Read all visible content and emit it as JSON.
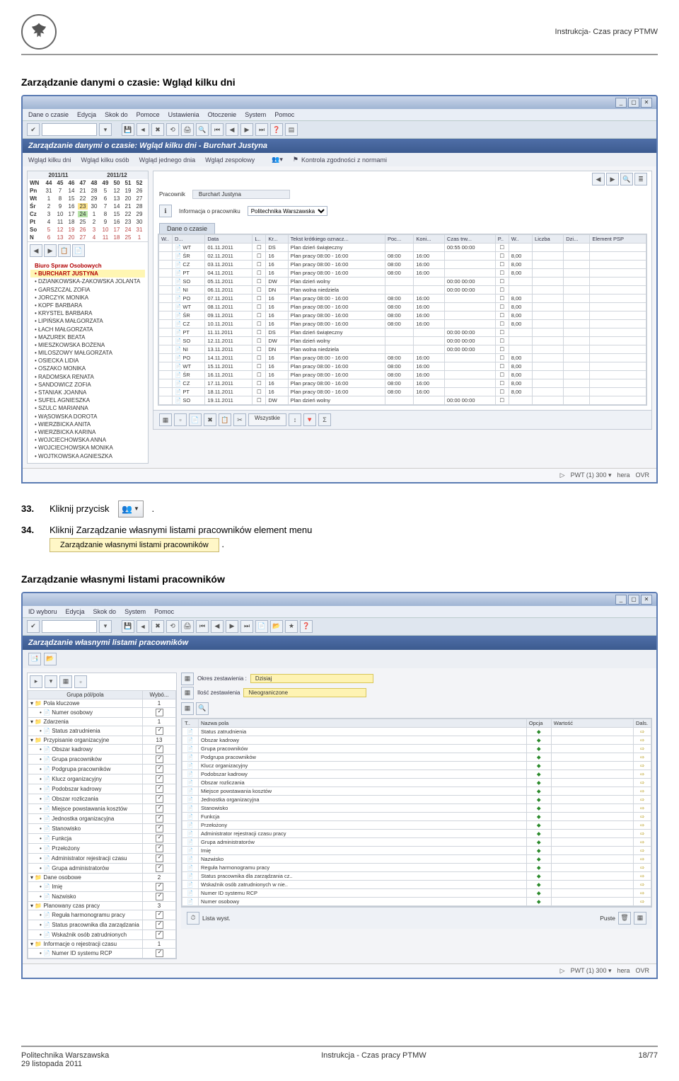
{
  "doc": {
    "header_title": "Instrukcja- Czas pracy PTMW",
    "footer_org": "Politechnika Warszawska",
    "footer_date": "29 listopada 2011",
    "footer_center": "Instrukcja - Czas pracy PTMW",
    "footer_page": "18/77"
  },
  "heading1": "Zarządzanie danymi o czasie: Wgląd kilku dni",
  "heading2": "Zarządzanie własnymi listami pracowników",
  "steps": {
    "n33": "33.",
    "s33_text": "Kliknij przycisk",
    "s33_dot": ".",
    "n34": "34.",
    "s34_text": "Kliknij Zarządzanie własnymi listami pracowników element menu",
    "s34_menu": "Zarządzanie własnymi listami pracowników",
    "s34_dot": "."
  },
  "sap1": {
    "titlebar": "",
    "menu": [
      "Dane o czasie",
      "Edycja",
      "Skok do",
      "Pomoce",
      "Ustawienia",
      "Otoczenie",
      "System",
      "Pomoc"
    ],
    "blue_title": "Zarządzanie danymi o czasie: Wgląd kilku dni - Burchart Justyna",
    "subtoolbar": [
      "Wgląd kilku dni",
      "Wgląd kilku osób",
      "Wgląd jednego dnia",
      "Wgląd zespołowy"
    ],
    "conformity_label": "Kontrola zgodności z normami",
    "cal_months": [
      "2011/11",
      "2011/12"
    ],
    "cal_head": [
      "44",
      "45",
      "46",
      "47",
      "48",
      "49",
      "50",
      "51",
      "52"
    ],
    "cal_rows": [
      {
        "l": "WN",
        "v": [
          "44",
          "45",
          "46",
          "47",
          "48",
          "49",
          "50",
          "51",
          "52"
        ]
      },
      {
        "l": "Pn",
        "v": [
          "31",
          "7",
          "14",
          "21",
          "28",
          "5",
          "12",
          "19",
          "26"
        ]
      },
      {
        "l": "Wt",
        "v": [
          "1",
          "8",
          "15",
          "22",
          "29",
          "6",
          "13",
          "20",
          "27"
        ]
      },
      {
        "l": "Śr",
        "v": [
          "2",
          "9",
          "16",
          "23",
          "30",
          "7",
          "14",
          "21",
          "28"
        ]
      },
      {
        "l": "Cz",
        "v": [
          "3",
          "10",
          "17",
          "24",
          "1",
          "8",
          "15",
          "22",
          "29"
        ]
      },
      {
        "l": "Pt",
        "v": [
          "4",
          "11",
          "18",
          "25",
          "2",
          "9",
          "16",
          "23",
          "30"
        ]
      },
      {
        "l": "So",
        "v": [
          "5",
          "12",
          "19",
          "26",
          "3",
          "10",
          "17",
          "24",
          "31"
        ]
      },
      {
        "l": "N",
        "v": [
          "6",
          "13",
          "20",
          "27",
          "4",
          "11",
          "18",
          "25",
          "1"
        ]
      }
    ],
    "group_title": "Biuro Spraw Osobowych",
    "employees": [
      "BURCHART JUSTYNA",
      "DZIANKOWSKA-ZAKOWSKA JOLANTA",
      "GARSZCZAL ZOFIA",
      "JORCZYK MONIKA",
      "KOPF BARBARA",
      "KRYSTEL BARBARA",
      "LIPIŃSKA MAŁGORZATA",
      "ŁACH MAŁGORZATA",
      "MAZUREK BEATA",
      "MIESZKOWSKA BOŻENA",
      "MILOSZOWY MAŁGORZATA",
      "OSIECKA LIDIA",
      "OSZAKO MONIKA",
      "RADOMSKA RENATA",
      "SANDOWICZ ZOFIA",
      "STANIAK JOANNA",
      "SUFEL AGNIESZKA",
      "SZULC MARIANNA",
      "WĄSOWSKA DOROTA",
      "WIERZBICKA ANITA",
      "WIERZBICKA KARINA",
      "WOJCIECHOWSKA ANNA",
      "WOJCIECHOWSKA MONIKA",
      "WOJTKOWSKA AGNIESZKA"
    ],
    "employee_label": "Pracownik",
    "employee_value": "Burchart Justyna",
    "info_label": "Informacja o pracowniku",
    "info_value": "Politechnika Warszawska",
    "tab_label": "Dane o czasie",
    "grid_headers": [
      "W..",
      "D...",
      "Data",
      "L..",
      "Kr...",
      "Tekst krótkiego oznacz...",
      "Poc...",
      "Koni...",
      "Czas trw...",
      "P..",
      "W..",
      "Liczba",
      "Dzi...",
      "Element PSP"
    ],
    "grid_rows": [
      {
        "w": "",
        "d": "WT",
        "data": "01.11.2011",
        "l": "",
        "kr": "DS",
        "t": "Plan dzień świąteczny",
        "poc": "",
        "kon": "",
        "czas": "00:55 00:00",
        "p": "",
        "wn": "",
        "licz": ""
      },
      {
        "w": "",
        "d": "ŚR",
        "data": "02.11.2011",
        "l": "",
        "kr": "16",
        "t": "Plan pracy 08:00 - 16:00",
        "poc": "08:00",
        "kon": "16:00",
        "czas": "",
        "p": "",
        "wn": "8,00",
        "licz": ""
      },
      {
        "w": "",
        "d": "CZ",
        "data": "03.11.2011",
        "l": "",
        "kr": "16",
        "t": "Plan pracy 08:00 - 16:00",
        "poc": "08:00",
        "kon": "16:00",
        "czas": "",
        "p": "",
        "wn": "8,00",
        "licz": ""
      },
      {
        "w": "",
        "d": "PT",
        "data": "04.11.2011",
        "l": "",
        "kr": "16",
        "t": "Plan pracy 08:00 - 16:00",
        "poc": "08:00",
        "kon": "16:00",
        "czas": "",
        "p": "",
        "wn": "8,00",
        "licz": ""
      },
      {
        "w": "",
        "d": "SO",
        "data": "05.11.2011",
        "l": "",
        "kr": "DW",
        "t": "Plan dzień wolny",
        "poc": "",
        "kon": "",
        "czas": "00:00 00:00",
        "p": "",
        "wn": "",
        "licz": ""
      },
      {
        "w": "",
        "d": "NI",
        "data": "06.11.2011",
        "l": "",
        "kr": "DN",
        "t": "Plan wolna niedziela",
        "poc": "",
        "kon": "",
        "czas": "00:00 00:00",
        "p": "",
        "wn": "",
        "licz": ""
      },
      {
        "w": "",
        "d": "PO",
        "data": "07.11.2011",
        "l": "",
        "kr": "16",
        "t": "Plan pracy 08:00 - 16:00",
        "poc": "08:00",
        "kon": "16:00",
        "czas": "",
        "p": "",
        "wn": "8,00",
        "licz": ""
      },
      {
        "w": "",
        "d": "WT",
        "data": "08.11.2011",
        "l": "",
        "kr": "16",
        "t": "Plan pracy 08:00 - 16:00",
        "poc": "08:00",
        "kon": "16:00",
        "czas": "",
        "p": "",
        "wn": "8,00",
        "licz": ""
      },
      {
        "w": "",
        "d": "ŚR",
        "data": "09.11.2011",
        "l": "",
        "kr": "16",
        "t": "Plan pracy 08:00 - 16:00",
        "poc": "08:00",
        "kon": "16:00",
        "czas": "",
        "p": "",
        "wn": "8,00",
        "licz": ""
      },
      {
        "w": "",
        "d": "CZ",
        "data": "10.11.2011",
        "l": "",
        "kr": "16",
        "t": "Plan pracy 08:00 - 16:00",
        "poc": "08:00",
        "kon": "16:00",
        "czas": "",
        "p": "",
        "wn": "8,00",
        "licz": ""
      },
      {
        "w": "",
        "d": "PT",
        "data": "11.11.2011",
        "l": "",
        "kr": "DS",
        "t": "Plan dzień świąteczny",
        "poc": "",
        "kon": "",
        "czas": "00:00 00:00",
        "p": "",
        "wn": "",
        "licz": ""
      },
      {
        "w": "",
        "d": "SO",
        "data": "12.11.2011",
        "l": "",
        "kr": "DW",
        "t": "Plan dzień wolny",
        "poc": "",
        "kon": "",
        "czas": "00:00 00:00",
        "p": "",
        "wn": "",
        "licz": ""
      },
      {
        "w": "",
        "d": "NI",
        "data": "13.11.2011",
        "l": "",
        "kr": "DN",
        "t": "Plan wolna niedziela",
        "poc": "",
        "kon": "",
        "czas": "00:00 00:00",
        "p": "",
        "wn": "",
        "licz": ""
      },
      {
        "w": "",
        "d": "PO",
        "data": "14.11.2011",
        "l": "",
        "kr": "16",
        "t": "Plan pracy 08:00 - 16:00",
        "poc": "08:00",
        "kon": "16:00",
        "czas": "",
        "p": "",
        "wn": "8,00",
        "licz": ""
      },
      {
        "w": "",
        "d": "WT",
        "data": "15.11.2011",
        "l": "",
        "kr": "16",
        "t": "Plan pracy 08:00 - 16:00",
        "poc": "08:00",
        "kon": "16:00",
        "czas": "",
        "p": "",
        "wn": "8,00",
        "licz": ""
      },
      {
        "w": "",
        "d": "ŚR",
        "data": "16.11.2011",
        "l": "",
        "kr": "16",
        "t": "Plan pracy 08:00 - 16:00",
        "poc": "08:00",
        "kon": "16:00",
        "czas": "",
        "p": "",
        "wn": "8,00",
        "licz": ""
      },
      {
        "w": "",
        "d": "CZ",
        "data": "17.11.2011",
        "l": "",
        "kr": "16",
        "t": "Plan pracy 08:00 - 16:00",
        "poc": "08:00",
        "kon": "16:00",
        "czas": "",
        "p": "",
        "wn": "8,00",
        "licz": ""
      },
      {
        "w": "",
        "d": "PT",
        "data": "18.11.2011",
        "l": "",
        "kr": "16",
        "t": "Plan pracy 08:00 - 16:00",
        "poc": "08:00",
        "kon": "16:00",
        "czas": "",
        "p": "",
        "wn": "8,00",
        "licz": ""
      },
      {
        "w": "",
        "d": "SO",
        "data": "19.11.2011",
        "l": "",
        "kr": "DW",
        "t": "Plan dzień wolny",
        "poc": "",
        "kon": "",
        "czas": "00:00 00:00",
        "p": "",
        "wn": "",
        "licz": ""
      }
    ],
    "bottom_label": "Wszystkie",
    "status": {
      "a": "PWT (1) 300 ▾",
      "b": "hera",
      "c": "OVR"
    }
  },
  "sap2": {
    "menu": [
      "ID wyboru",
      "Edycja",
      "Skok do",
      "System",
      "Pomoc"
    ],
    "blue_title": "Zarządzanie własnymi listami pracowników",
    "tree_headers": [
      "Grupa pól/pola",
      "Wybó..."
    ],
    "tree": [
      {
        "n": "Pola kluczowe",
        "v": "1",
        "ch": [
          {
            "n": "Numer osobowy",
            "v": "✓"
          }
        ]
      },
      {
        "n": "Zdarzenia",
        "v": "1",
        "ch": [
          {
            "n": "Status zatrudnienia",
            "v": "✓"
          }
        ]
      },
      {
        "n": "Przypisanie organizacyjne",
        "v": "13",
        "ch": [
          {
            "n": "Obszar kadrowy",
            "v": "✓"
          },
          {
            "n": "Grupa pracowników",
            "v": "✓"
          },
          {
            "n": "Podgrupa pracowników",
            "v": "✓"
          },
          {
            "n": "Klucz organizacyjny",
            "v": "✓"
          },
          {
            "n": "Podobszar kadrowy",
            "v": "✓"
          },
          {
            "n": "Obszar rozliczania",
            "v": "✓"
          },
          {
            "n": "Miejsce powstawania kosztów",
            "v": "✓"
          },
          {
            "n": "Jednostka organizacyjna",
            "v": "✓"
          },
          {
            "n": "Stanowisko",
            "v": "✓"
          },
          {
            "n": "Funkcja",
            "v": "✓"
          },
          {
            "n": "Przełożony",
            "v": "✓"
          },
          {
            "n": "Administrator rejestracji czasu",
            "v": "✓"
          },
          {
            "n": "Grupa administratorów",
            "v": "✓"
          }
        ]
      },
      {
        "n": "Dane osobowe",
        "v": "2",
        "ch": [
          {
            "n": "Imię",
            "v": "✓"
          },
          {
            "n": "Nazwisko",
            "v": "✓"
          }
        ]
      },
      {
        "n": "Planowany czas pracy",
        "v": "3",
        "ch": [
          {
            "n": "Reguła harmonogramu pracy",
            "v": "✓"
          },
          {
            "n": "Status pracownika dla zarządzania",
            "v": "✓"
          },
          {
            "n": "Wskaźnik osób zatrudnionych",
            "v": "✓"
          }
        ]
      },
      {
        "n": "Informacje o rejestracji czasu",
        "v": "1",
        "ch": [
          {
            "n": "Numer ID systemu RCP",
            "v": "✓"
          }
        ]
      }
    ],
    "filter_date_label": "Okres zestawienia   :",
    "filter_date_val": "Dzisiaj",
    "filter_count_label": "Ilość zestawienia",
    "filter_count_val": "Nieograniczone",
    "ftable_headers": [
      "T..",
      "Nazwa pola",
      "Opcja",
      "Wartość",
      "Dals."
    ],
    "ftable_rows": [
      "Status zatrudnienia",
      "Obszar kadrowy",
      "Grupa pracowników",
      "Podgrupa pracowników",
      "Klucz organizacyjny",
      "Podobszar kadrowy",
      "Obszar rozliczania",
      "Miejsce powstawania kosztów",
      "Jednostka organizacyjna",
      "Stanowisko",
      "Funkcja",
      "Przełożony",
      "Administrator rejestracji czasu pracy",
      "Grupa administratorów",
      "Imię",
      "Nazwisko",
      "Reguła harmonogramu pracy",
      "Status pracownika dla zarządzania cz..",
      "Wskaźnik osób zatrudnionych w nie..",
      "Numer ID systemu RCP",
      "Numer osobowy"
    ],
    "bottom_left": "Lista wyst.",
    "bottom_right": "Puste",
    "status": {
      "a": "PWT (1) 300 ▾",
      "b": "hera",
      "c": "OVR"
    }
  }
}
